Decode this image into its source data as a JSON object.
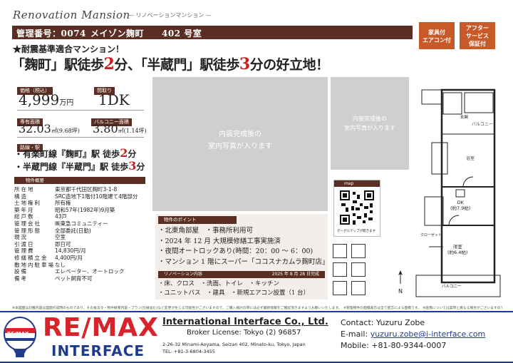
{
  "header": {
    "title_en": "Renovation Mansion",
    "title_jp": "— リノベーションマンション —",
    "mgmt_no": "管理番号：0074",
    "building": "メイゾン麹町",
    "room": "402 号室"
  },
  "badges": [
    {
      "label": "家具付\nエアコン付"
    },
    {
      "label": "アフター\nサービス\n保証付"
    }
  ],
  "tagline": "★耐震基準適合マンション！",
  "headline": {
    "part1": "「麹町」駅徒歩",
    "num1": "2",
    "part2": "分、「半蔵門」駅徒歩",
    "num2": "3",
    "part3": "分の好立地！"
  },
  "summary": {
    "price_label": "価格（税込）",
    "price_value": "4,999",
    "price_unit": "万円",
    "layout_label": "間取り",
    "layout_value": "1DK",
    "area_label": "専有面積",
    "area_value": "32.03",
    "area_unit": "㎡(9.68坪)",
    "balcony_label": "バルコニー面積",
    "balcony_value": "3.80",
    "balcony_unit": "㎡(1.14坪)",
    "station_label": "路線・駅",
    "line1_text": "・有楽町線『麹町』駅 徒歩",
    "line1_num": "2",
    "line1_unit": "分",
    "line2_text": "・半蔵門線『半蔵門』駅 徒歩",
    "line2_num": "3",
    "line2_unit": "分"
  },
  "overview": {
    "label": "物件概要",
    "rows": [
      {
        "k": "所在地",
        "v": "東京都千代田区麹町3-1-8"
      },
      {
        "k": "構造",
        "v": "SRC造地下1階付10階建て4階部分"
      },
      {
        "k": "土地権利",
        "v": "所有権"
      },
      {
        "k": "築年月",
        "v": "昭和57年(1982年)9月築"
      },
      {
        "k": "総戸数",
        "v": "43戸"
      },
      {
        "k": "管理会社",
        "v": "㈱東急コミュニティー"
      },
      {
        "k": "管理形態",
        "v": "全部委託(日勤)"
      },
      {
        "k": "現況",
        "v": "空室"
      },
      {
        "k": "引渡日",
        "v": "即日可"
      },
      {
        "k": "管理費",
        "v": "14,830円/月"
      },
      {
        "k": "修繕積立金",
        "v": "4,400円/月"
      },
      {
        "k": "敷地内駐車場",
        "v": "なし"
      },
      {
        "k": "設備",
        "v": "エレベーター、オートロック"
      },
      {
        "k": "備考",
        "v": "ペット飼育不可"
      }
    ]
  },
  "photos": {
    "main": "内装完成後の\n室内写真が入ります",
    "small": "内装完成後の\n室内写真が入ります"
  },
  "map": {
    "label": "map",
    "caption": "グーグルマップが開きます"
  },
  "points": {
    "label": "物件のポイント",
    "items": [
      "・北東角部屋　・事務所利用可",
      "・2024 年 12 月 大規模修繕工事実施済",
      "・夜間オートロックあり(時間：20：00 ～ 6：00)",
      "・マンション 1 階にスーパー「ココスナカムラ麹町店」"
    ]
  },
  "renovation": {
    "label": "リノベーション内容",
    "date": "2025 年 8 月 28 日完成",
    "items": [
      "・床、クロス　・洗面、トイレ　・キッチン",
      "・ユニットバス　・建具　・新規エアコン設置（1 台）"
    ]
  },
  "floorplan": {
    "dk": "DK\n(約7.9帖)",
    "western": "洋室\n(約6.4帖)",
    "balcony": "バルコニー",
    "entrance": "玄関",
    "north": "N",
    "closet": "クローゼット",
    "bath": "浴室"
  },
  "disclaimer": "※本図面は記載内容は図面作成時のものであり、その後法令・物件概要内容・プラン(仕様含む)など変更が生じる可能性がございますので、ご購入検討の際には必ず最新情報をご確認頂きますようお願いいたします。　※管理物件の面積表示は全て壁芯による面積です。　※画像については実際と異なる場合がございますのでご了承ください。",
  "footer": {
    "company_en": "International Interface Co., Ltd.",
    "license": "Broker License: Tokyo (2) 96857",
    "address": "2-26-32 Minami-Aoyama, Seizan 402, Minato-ku, Tokyo, Japan",
    "tel": "TEL: +81-3-6804-3455",
    "contact": "Contact: Yuzuru Zobe",
    "email_label": "E-mail: ",
    "email": "yuzuru.zobe@i-interface.com",
    "mobile": "Mobile: +81-80-9344-0007",
    "brand_top": "RE/MAX",
    "brand_bottom": "INTERFACE",
    "balloon": "RE/MAX"
  },
  "colors": {
    "brown": "#5a2e22",
    "red": "#c8201b",
    "orange": "#c85a27",
    "remax_red": "#d8232a",
    "remax_blue": "#1f3b8a"
  }
}
